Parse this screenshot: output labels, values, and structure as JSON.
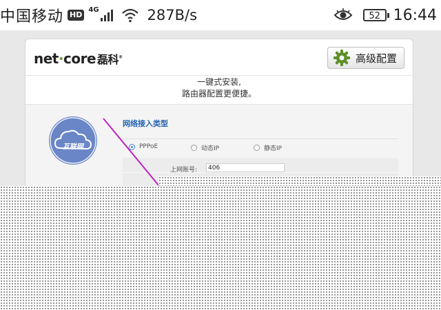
{
  "status_bar": {
    "carrier": "中国移动",
    "hd_badge": "HD",
    "network_type": "4G",
    "speed": "287B/s",
    "battery": "52",
    "time": "16:44",
    "icons": [
      "signal-icon",
      "wifi-icon",
      "eye-icon",
      "battery-icon"
    ]
  },
  "router_page": {
    "logo": {
      "brand": "net",
      "brand_dot": "·",
      "brand_tail": "core",
      "brand_cn": "磊科",
      "trademark": "®"
    },
    "advanced_button": "高级配置",
    "tagline_line1": "一键式安装,",
    "tagline_line2": "路由器配置更便捷。",
    "cloud_label": "互联网",
    "section_title": "网络接入类型",
    "connection_types": [
      {
        "label": "PPPoE",
        "selected": true
      },
      {
        "label": "动态IP",
        "selected": false
      },
      {
        "label": "静态IP",
        "selected": false
      }
    ],
    "account_label": "上网账号:",
    "account_value": "406"
  },
  "colors": {
    "accent_blue": "#2766b0",
    "cloud_circle": "#6a86c7",
    "annotation_arrow": "#c020c0",
    "gear_green": "#5f8f2a"
  }
}
